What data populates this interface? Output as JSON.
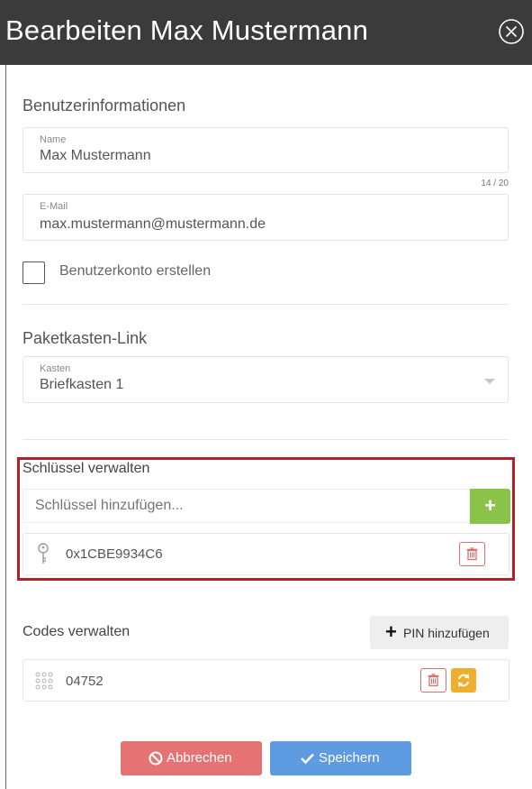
{
  "header": {
    "title": "Bearbeiten Max Mustermann",
    "close_icon": "close-circle-icon"
  },
  "user_info": {
    "section_title": "Benutzerinformationen",
    "name_label": "Name",
    "name_value": "Max Mustermann",
    "name_counter": "14 / 20",
    "email_label": "E-Mail",
    "email_value": "max.mustermann@mustermann.de",
    "create_account_label": "Benutzerkonto erstellen",
    "create_account_checked": false
  },
  "paketkasten": {
    "section_title": "Paketkasten-Link",
    "select_label": "Kasten",
    "select_value": "Briefkasten 1"
  },
  "keys": {
    "section_title": "Schlüssel verwalten",
    "input_placeholder": "Schlüssel hinzufügen...",
    "add_button_label": "+",
    "items": [
      {
        "id": "0x1CBE9934C6",
        "icon": "key-icon"
      }
    ]
  },
  "codes": {
    "section_title": "Codes verwalten",
    "add_pin_label": "PIN hinzufügen",
    "items": [
      {
        "code": "04752",
        "icon": "keypad-icon"
      }
    ]
  },
  "footer": {
    "cancel_label": "Abbrechen",
    "save_label": "Speichern"
  },
  "colors": {
    "header_bg": "#3b3b3b",
    "highlight": "#b51f27",
    "add_green": "#8bc34a",
    "delete_red": "#e06b6b",
    "refresh_orange": "#f0ad2e",
    "cancel_bg": "#e57373",
    "save_bg": "#5e9be0"
  }
}
